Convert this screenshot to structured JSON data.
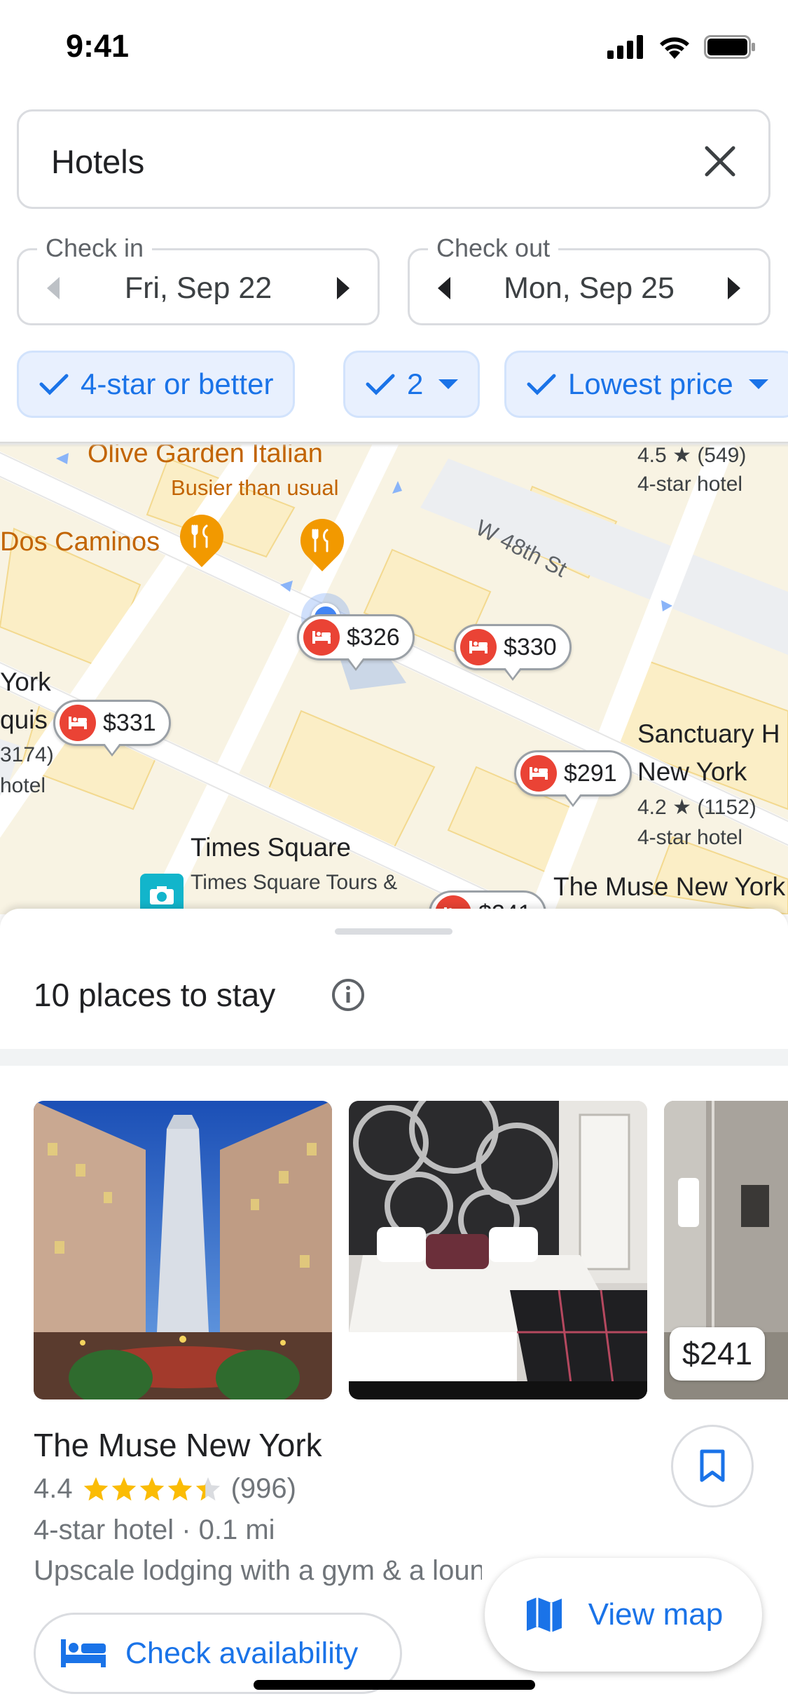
{
  "status_bar": {
    "time": "9:41"
  },
  "search": {
    "query": "Hotels"
  },
  "dates": {
    "check_in_label": "Check in",
    "check_in_value": "Fri, Sep 22",
    "check_out_label": "Check out",
    "check_out_value": "Mon, Sep 25"
  },
  "filters": [
    {
      "label": "4-star or better"
    },
    {
      "label": "2"
    },
    {
      "label": "Lowest price"
    }
  ],
  "map": {
    "street": "W 48th St",
    "olive_garden": "Olive Garden Italian",
    "olive_garden_status": "Busier than usual",
    "dos_caminos": "Dos Caminos",
    "top_hotel_rating": "4.5",
    "top_hotel_reviews": "(549)",
    "top_hotel_type": "4-star hotel",
    "left_hotel_line1": "York",
    "left_hotel_line2": "quis",
    "left_hotel_reviews": "3174)",
    "left_hotel_type": "hotel",
    "sanctuary_line1": "Sanctuary H",
    "sanctuary_line2": "New York",
    "sanctuary_rating": "4.2",
    "sanctuary_reviews": "(1152)",
    "sanctuary_type": "4-star hotel",
    "times_square": "Times Square",
    "times_square_tours": "Times Square Tours &",
    "muse_label": "The Muse New York",
    "prices": [
      "$326",
      "$330",
      "$331",
      "$291",
      "$241"
    ]
  },
  "results": {
    "title": "10 places to stay"
  },
  "hotel": {
    "name": "The Muse New York",
    "rating": "4.4",
    "rating_value": 4.4,
    "reviews": "(996)",
    "meta": "4-star hotel · 0.1 mi",
    "description": "Upscale lodging with a gym & a lounge",
    "price": "$241"
  },
  "actions": {
    "check_availability": "Check availability",
    "view_map": "View map"
  },
  "colors": {
    "accent": "#1a73e8",
    "star": "#fbbc04",
    "hotel_pin": "#ea4335",
    "food_pin": "#f29900",
    "chip_bg": "#e8f0fe"
  }
}
